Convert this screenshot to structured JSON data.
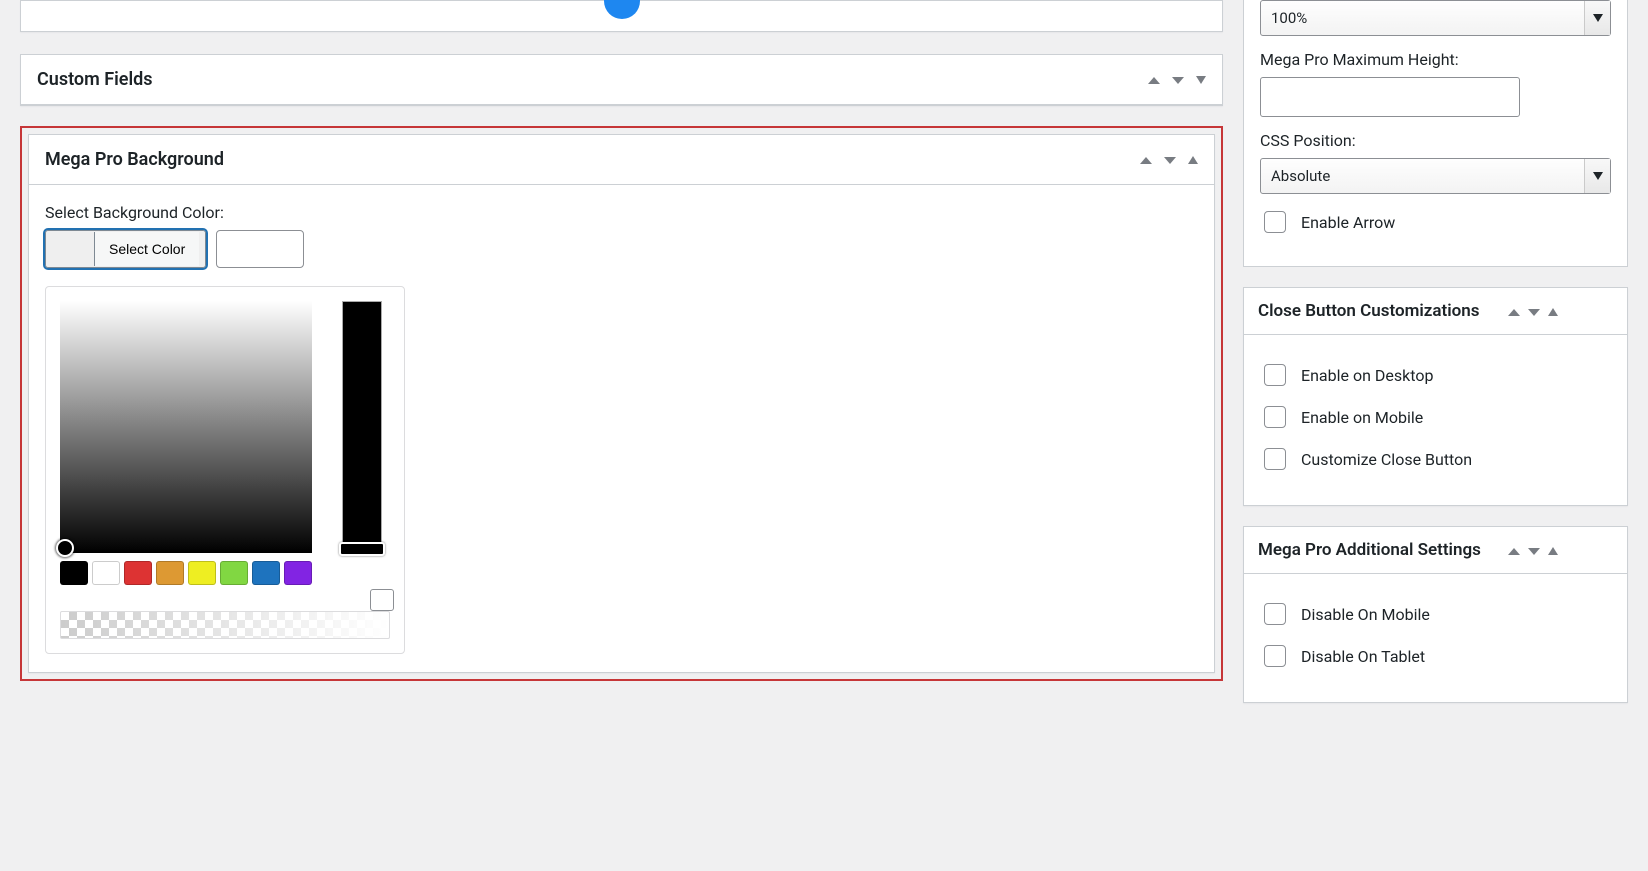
{
  "main": {
    "panels": {
      "custom_fields": {
        "title": "Custom Fields"
      },
      "mega_bg": {
        "title": "Mega Pro Background",
        "select_bg_label": "Select Background Color:",
        "select_color_btn": "Select Color",
        "hex_value": "",
        "palette": [
          "#000000",
          "#ffffff",
          "#dd3333",
          "#dd9933",
          "#eeee22",
          "#81d742",
          "#1e73be",
          "#8224e3"
        ]
      }
    }
  },
  "sidebar": {
    "top_open": {
      "width_select_value": "100%",
      "max_height_label": "Mega Pro Maximum Height:",
      "max_height_value": "",
      "css_position_label": "CSS Position:",
      "css_position_value": "Absolute",
      "enable_arrow_label": "Enable Arrow"
    },
    "close_btn": {
      "title": "Close Button Customizations",
      "items": [
        "Enable on Desktop",
        "Enable on Mobile",
        "Customize Close Button"
      ]
    },
    "additional": {
      "title": "Mega Pro Additional Settings",
      "items": [
        "Disable On Mobile",
        "Disable On Tablet"
      ]
    }
  }
}
